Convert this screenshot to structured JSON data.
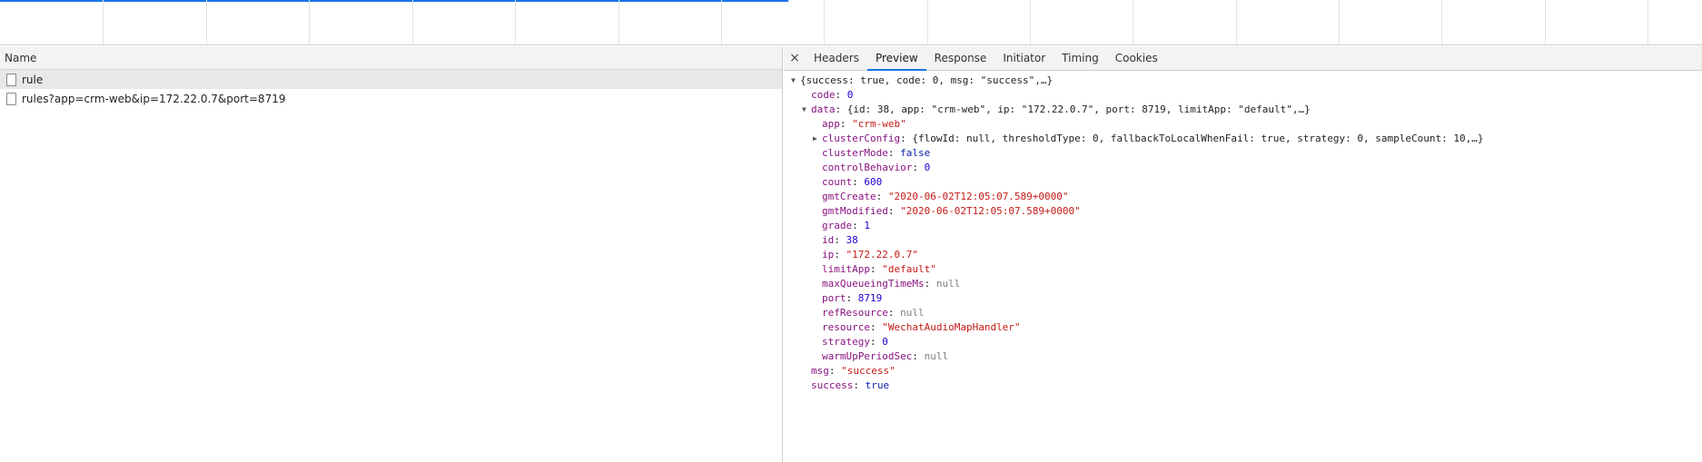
{
  "timeline": {
    "progress_fraction": 0.463
  },
  "request_list": {
    "column_header": "Name",
    "rows": [
      {
        "name": "rule",
        "selected": true
      },
      {
        "name": "rules?app=crm-web&ip=172.22.0.7&port=8719",
        "selected": false
      }
    ]
  },
  "detail": {
    "close_label": "×",
    "tabs": [
      "Headers",
      "Preview",
      "Response",
      "Initiator",
      "Timing",
      "Cookies"
    ],
    "active_tab": "Preview",
    "preview": {
      "root_summary": "{success: true, code: 0, msg: \"success\",…}",
      "code": {
        "key": "code",
        "value": "0"
      },
      "data_key": "data",
      "data_summary": "{id: 38, app: \"crm-web\", ip: \"172.22.0.7\", port: 8719, limitApp: \"default\",…}",
      "data_fields": [
        {
          "key": "app",
          "value": "\"crm-web\"",
          "type": "string"
        },
        {
          "key": "clusterConfig",
          "value": "{flowId: null, thresholdType: 0, fallbackToLocalWhenFail: true, strategy: 0, sampleCount: 10,…}",
          "type": "object"
        },
        {
          "key": "clusterMode",
          "value": "false",
          "type": "bool"
        },
        {
          "key": "controlBehavior",
          "value": "0",
          "type": "number"
        },
        {
          "key": "count",
          "value": "600",
          "type": "number"
        },
        {
          "key": "gmtCreate",
          "value": "\"2020-06-02T12:05:07.589+0000\"",
          "type": "string"
        },
        {
          "key": "gmtModified",
          "value": "\"2020-06-02T12:05:07.589+0000\"",
          "type": "string"
        },
        {
          "key": "grade",
          "value": "1",
          "type": "number"
        },
        {
          "key": "id",
          "value": "38",
          "type": "number"
        },
        {
          "key": "ip",
          "value": "\"172.22.0.7\"",
          "type": "string"
        },
        {
          "key": "limitApp",
          "value": "\"default\"",
          "type": "string"
        },
        {
          "key": "maxQueueingTimeMs",
          "value": "null",
          "type": "null"
        },
        {
          "key": "port",
          "value": "8719",
          "type": "number"
        },
        {
          "key": "refResource",
          "value": "null",
          "type": "null"
        },
        {
          "key": "resource",
          "value": "\"WechatAudioMapHandler\"",
          "type": "string"
        },
        {
          "key": "strategy",
          "value": "0",
          "type": "number"
        },
        {
          "key": "warmUpPeriodSec",
          "value": "null",
          "type": "null"
        }
      ],
      "msg": {
        "key": "msg",
        "value": "\"success\""
      },
      "success": {
        "key": "success",
        "value": "true"
      }
    }
  },
  "colors": {
    "accent": "#1a73e8",
    "key": "#881280",
    "string": "#c41a16",
    "number": "#1c00cf",
    "null": "#808080"
  }
}
